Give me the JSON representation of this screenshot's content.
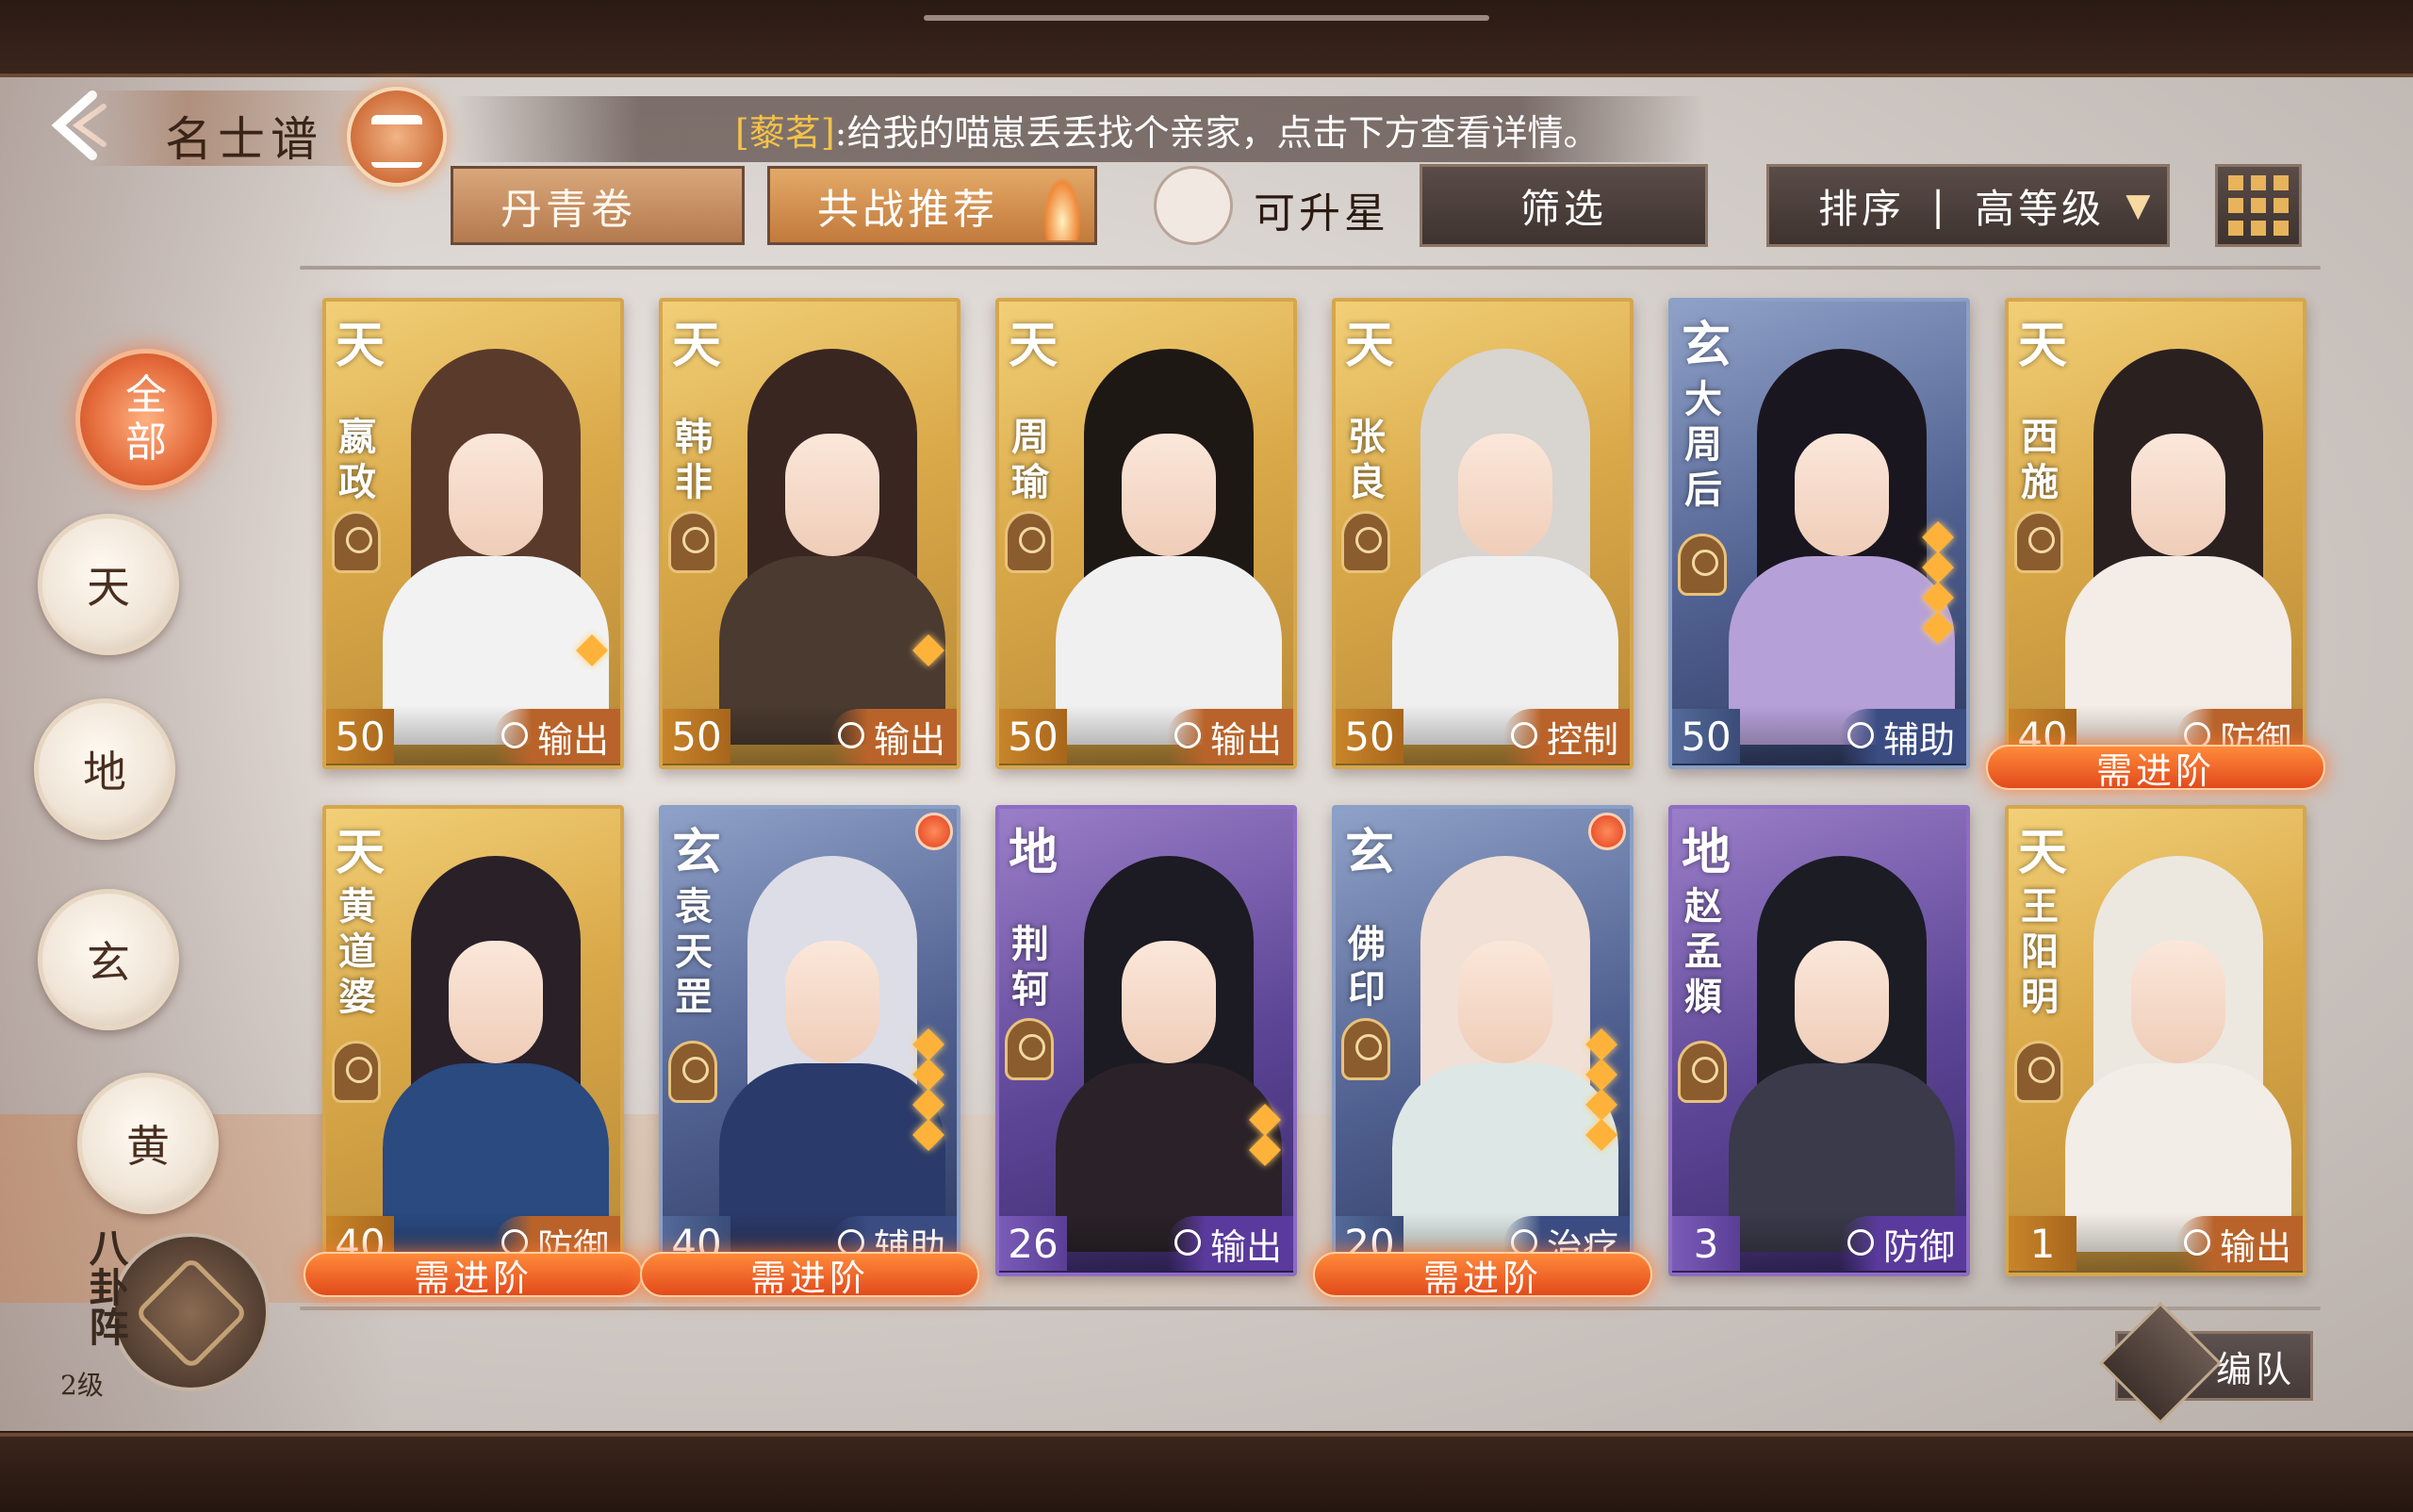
{
  "header": {
    "title": "名士谱",
    "notice_highlight": "[藜茗]",
    "notice_text": ":给我的喵崽丢丢找个亲家，点击下方查看详情。"
  },
  "toolbar": {
    "tab_scroll": "丹青卷",
    "tab_recommend": "共战推荐",
    "star_up_label": "可升星",
    "filter_label": "筛选",
    "sort_label": "排序",
    "sort_value": "高等级",
    "grid_icon": "grid-view-icon"
  },
  "side_filter": [
    {
      "label": "全部",
      "active": true
    },
    {
      "label": "天"
    },
    {
      "label": "地"
    },
    {
      "label": "玄"
    },
    {
      "label": "黄"
    }
  ],
  "bagua": {
    "label": "八卦阵",
    "level": "2级"
  },
  "advance_label": "需进阶",
  "team_button": "编队",
  "colors": {
    "tian": "#d9a848",
    "xuan": "#4f5f8f",
    "di": "#5d4596",
    "accent": "#e24a1c"
  },
  "cards": [
    {
      "name": "嬴政",
      "rarity": "天",
      "level": "50",
      "role": "输出",
      "stars": 1,
      "needs_advance": false,
      "red_dot": false
    },
    {
      "name": "韩非",
      "rarity": "天",
      "level": "50",
      "role": "输出",
      "stars": 1,
      "needs_advance": false,
      "red_dot": false
    },
    {
      "name": "周瑜",
      "rarity": "天",
      "level": "50",
      "role": "输出",
      "stars": 0,
      "needs_advance": false,
      "red_dot": false
    },
    {
      "name": "张良",
      "rarity": "天",
      "level": "50",
      "role": "控制",
      "stars": 0,
      "needs_advance": false,
      "red_dot": false
    },
    {
      "name": "大周后",
      "rarity": "玄",
      "level": "50",
      "role": "辅助",
      "stars": 4,
      "needs_advance": false,
      "red_dot": false
    },
    {
      "name": "西施",
      "rarity": "天",
      "level": "40",
      "role": "防御",
      "stars": 0,
      "needs_advance": true,
      "red_dot": false
    },
    {
      "name": "黄道婆",
      "rarity": "天",
      "level": "40",
      "role": "防御",
      "stars": 0,
      "needs_advance": true,
      "red_dot": false
    },
    {
      "name": "袁天罡",
      "rarity": "玄",
      "level": "40",
      "role": "辅助",
      "stars": 4,
      "needs_advance": true,
      "red_dot": true
    },
    {
      "name": "荆轲",
      "rarity": "地",
      "level": "26",
      "role": "输出",
      "stars": 2,
      "needs_advance": false,
      "red_dot": false
    },
    {
      "name": "佛印",
      "rarity": "玄",
      "level": "20",
      "role": "治疗",
      "stars": 4,
      "needs_advance": true,
      "red_dot": true
    },
    {
      "name": "赵孟頫",
      "rarity": "地",
      "level": "3",
      "role": "防御",
      "stars": 0,
      "needs_advance": false,
      "red_dot": false
    },
    {
      "name": "王阳明",
      "rarity": "天",
      "level": "1",
      "role": "输出",
      "stars": 0,
      "needs_advance": false,
      "red_dot": false
    }
  ]
}
